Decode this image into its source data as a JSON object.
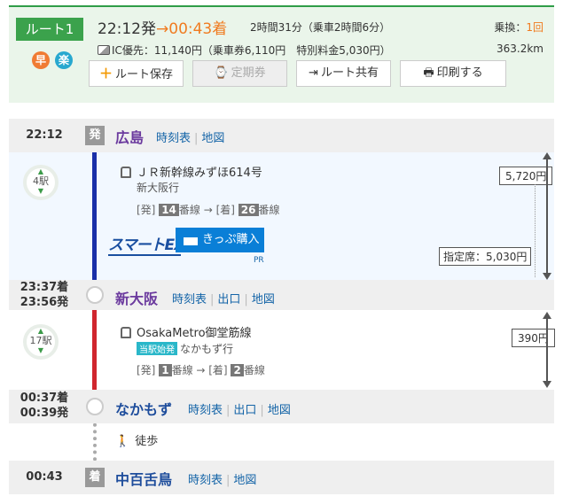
{
  "summary": {
    "route_label": "ルート1",
    "mark_fast": "早",
    "mark_cheap": "楽",
    "depart_time": "22:12発",
    "arrow": "→",
    "arrive_time": "00:43着",
    "duration": "2時間31分（乗車2時間6分）",
    "transfer_label": "乗換：",
    "transfer_count": "1回",
    "fare_text": "IC優先：11,140円（乗車券6,110円　特別料金5,030円）",
    "distance": "363.2km",
    "buttons": {
      "save": "ルート保存",
      "teiki": "定期券",
      "share": "ルート共有",
      "print": "印刷する"
    }
  },
  "stations": [
    {
      "time": "22:12",
      "mark": "発",
      "name": "広島",
      "links": [
        "時刻表",
        "地図"
      ]
    },
    {
      "time_arr": "23:37着",
      "time_dep": "23:56発",
      "name": "新大阪",
      "links": [
        "時刻表",
        "出口",
        "地図"
      ]
    },
    {
      "time_arr": "00:37着",
      "time_dep": "00:39発",
      "name": "なかもず",
      "links": [
        "時刻表",
        "出口",
        "地図"
      ]
    },
    {
      "time": "00:43",
      "mark": "着",
      "name": "中百舌鳥",
      "links": [
        "時刻表",
        "地図"
      ]
    }
  ],
  "segments": [
    {
      "stops": "4駅",
      "train": "ＪＲ新幹線みずほ614号",
      "dest": "新大阪行",
      "track_dep_label": "[発]",
      "track_dep": "14",
      "track_mid": "番線 → [着]",
      "track_arr": "26",
      "track_suffix": "番線",
      "fare": "5,720円",
      "reserved": "指定席：5,030円",
      "smartex": "スマートEX",
      "kippu": "きっぷ購入",
      "pr": "PR",
      "line_color": "#1a2fa8"
    },
    {
      "stops": "17駅",
      "train": "OsakaMetro御堂筋線",
      "first_station": "当駅始発",
      "dest": "なかもず行",
      "track_dep_label": "[発]",
      "track_dep": "1",
      "track_mid": "番線 → [着]",
      "track_arr": "2",
      "track_suffix": "番線",
      "fare": "390円",
      "line_color": "#d0262e"
    }
  ],
  "walk": {
    "label": "徒歩"
  }
}
